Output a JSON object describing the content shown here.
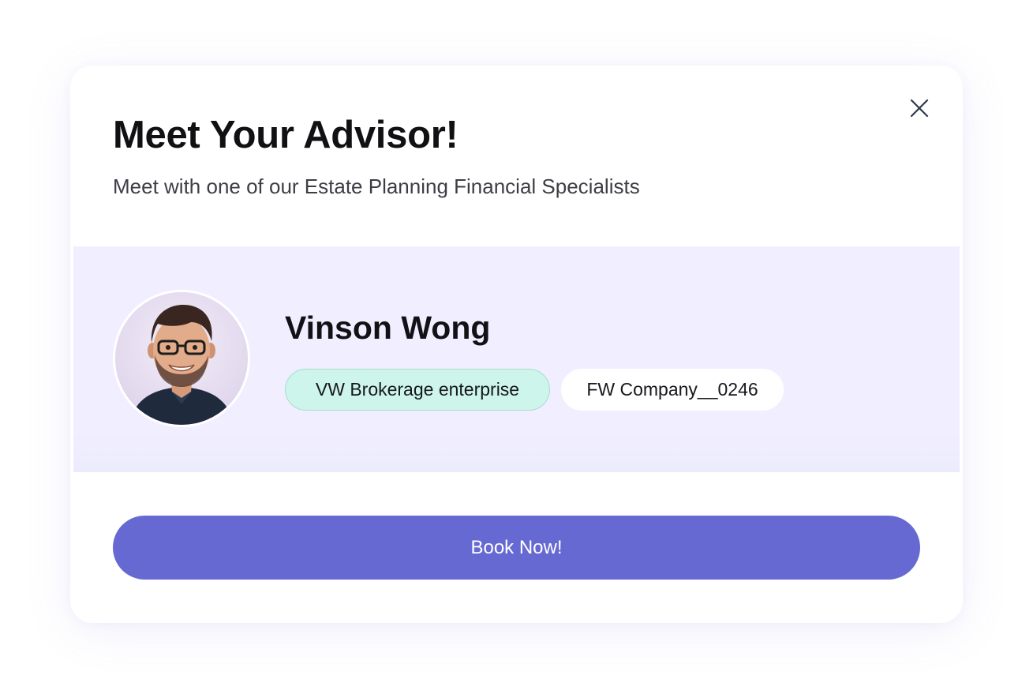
{
  "modal": {
    "title": "Meet Your Advisor!",
    "subtitle": "Meet with one of our Estate Planning Financial Specialists",
    "close_icon": "close-icon"
  },
  "advisor": {
    "name": "Vinson Wong",
    "avatar": "avatar-photo",
    "tags": [
      {
        "label": "VW Brokerage enterprise",
        "color": "#cdf5ec"
      },
      {
        "label": "FW Company__0246",
        "color": "#ffffff"
      }
    ]
  },
  "actions": {
    "book_label": "Book Now!"
  },
  "colors": {
    "accent": "#6669d2",
    "panel_background": "#f1efff",
    "tag_brokerage": "#cdf5ec"
  }
}
